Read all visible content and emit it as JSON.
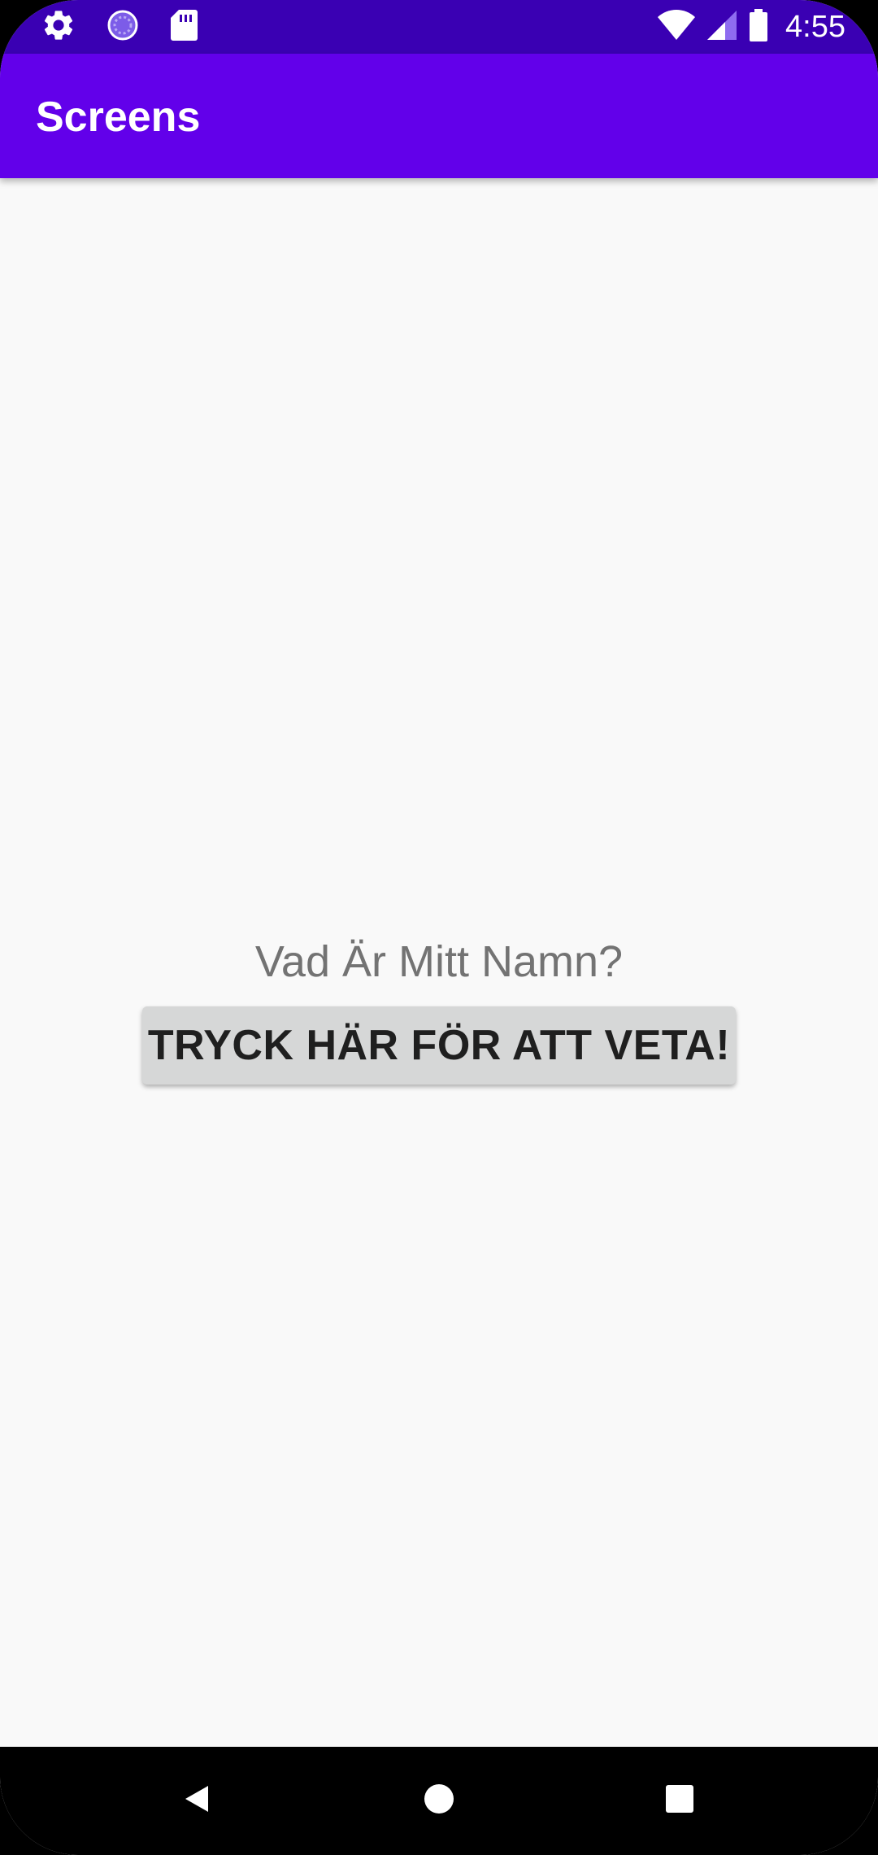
{
  "status_bar": {
    "time": "4:55",
    "left_icons": [
      "settings-icon",
      "sync-icon",
      "sd-card-icon"
    ],
    "right_icons": [
      "wifi-icon",
      "signal-icon",
      "battery-icon"
    ]
  },
  "app_bar": {
    "title": "Screens"
  },
  "main": {
    "question_text": "Vad Är Mitt Namn?",
    "button_label": "TRYCK HÄR FÖR ATT VETA!"
  },
  "nav_bar": {
    "buttons": [
      "back-icon",
      "home-icon",
      "recents-icon"
    ]
  },
  "colors": {
    "status_bar": "#3a00b3",
    "app_bar": "#6200ea",
    "background": "#f9f9f9",
    "button": "#d6d7d7",
    "question_text": "#737373"
  }
}
